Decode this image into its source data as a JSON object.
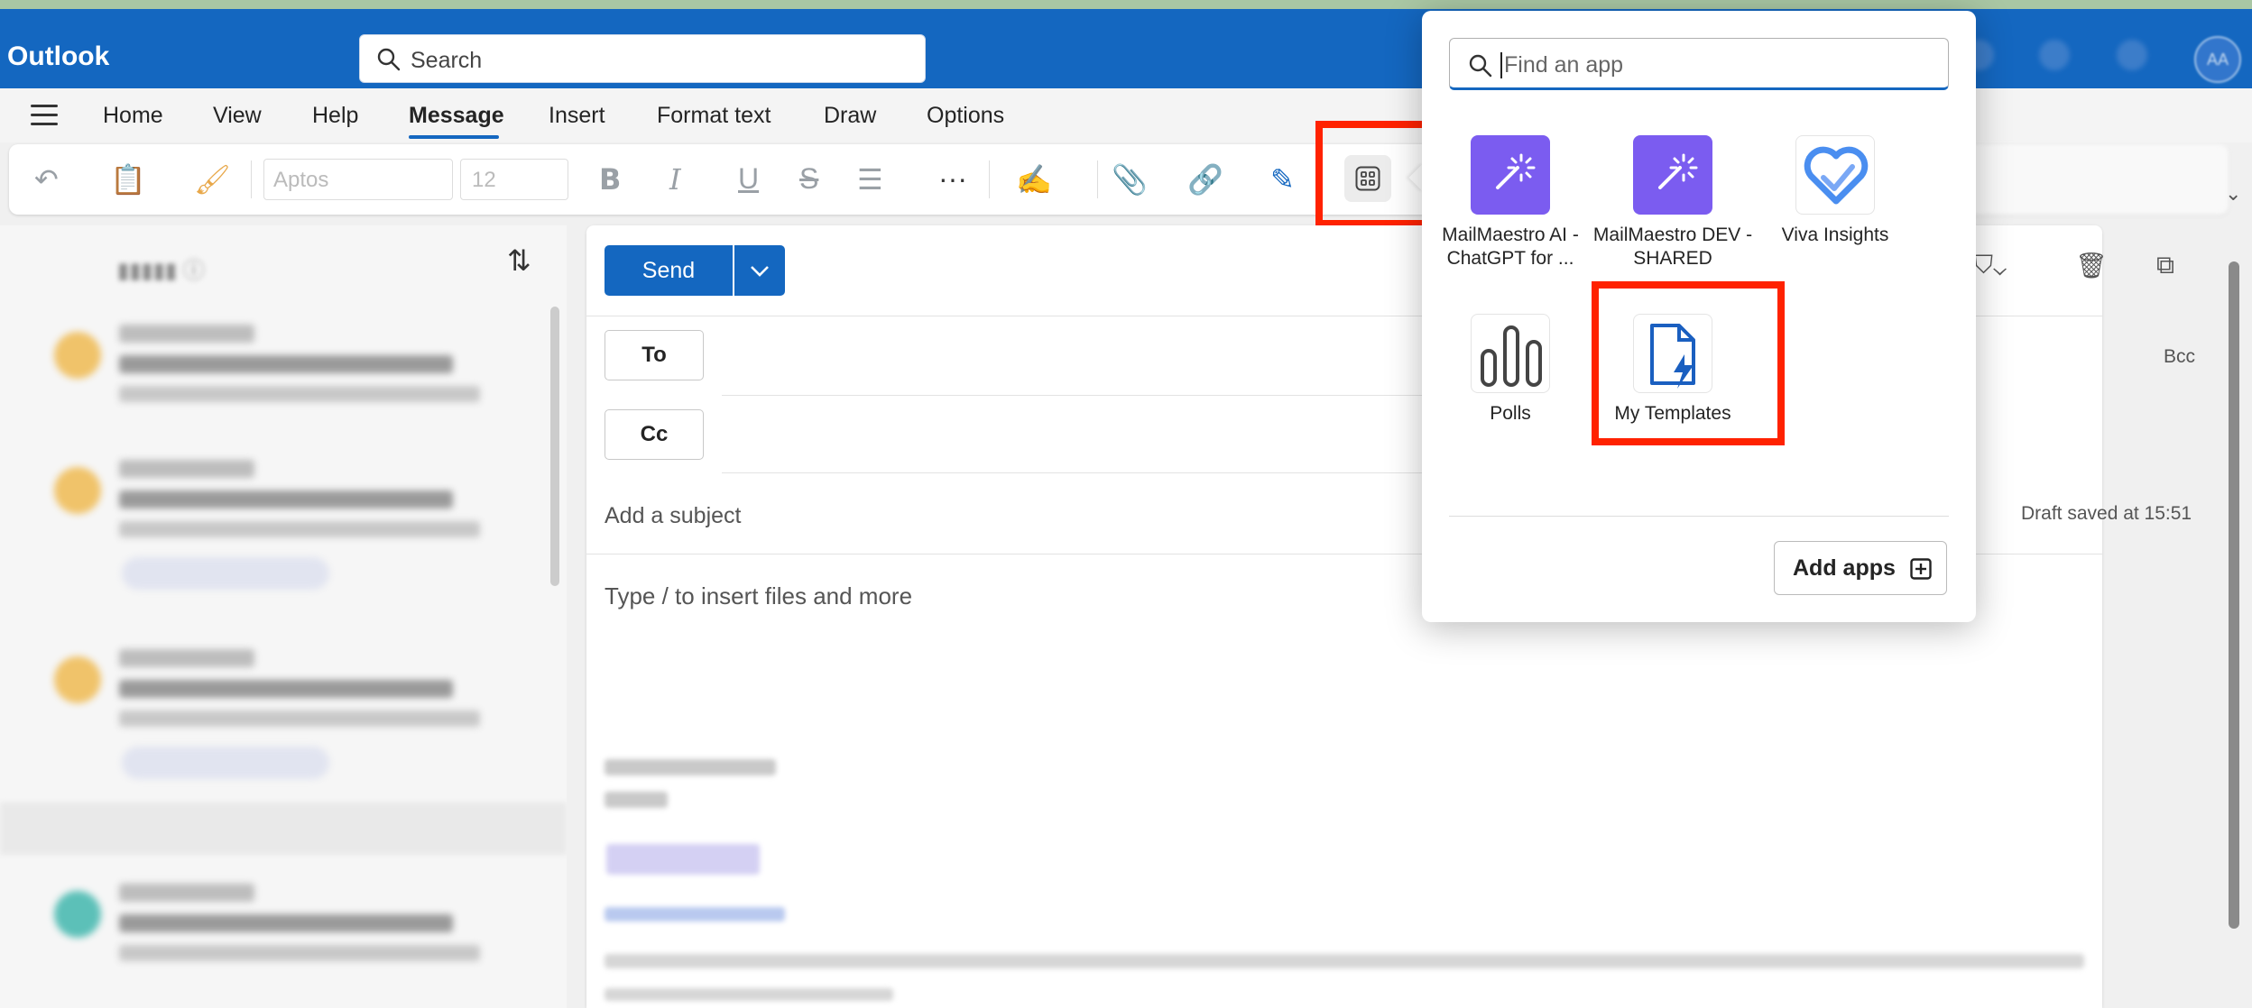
{
  "header": {
    "app_name": "Outlook",
    "search_placeholder": "Search",
    "avatar_initials": "AA"
  },
  "menu": {
    "tabs": [
      "Home",
      "View",
      "Help",
      "Message",
      "Insert",
      "Format text",
      "Draw",
      "Options"
    ],
    "active_tab": "Message"
  },
  "ribbon": {
    "font_name": "Aptos",
    "font_size": "12"
  },
  "compose": {
    "send_label": "Send",
    "to_label": "To",
    "cc_label": "Cc",
    "bcc_label": "Bcc",
    "subject_placeholder": "Add a subject",
    "body_placeholder": "Type / to insert files and more",
    "draft_status": "Draft saved at 15:51"
  },
  "apps_popup": {
    "search_placeholder": "Find an app",
    "apps": [
      {
        "label": "MailMaestro AI - ChatGPT for ...",
        "icon": "wand-icon",
        "color": "#7b5cf0"
      },
      {
        "label": "MailMaestro DEV - SHARED",
        "icon": "wand-icon",
        "color": "#7b5cf0"
      },
      {
        "label": "Viva Insights",
        "icon": "heart-check-icon",
        "color": "#4a8ef0"
      },
      {
        "label": "Polls",
        "icon": "poll-bars-icon",
        "color": "#4a4a4a"
      },
      {
        "label": "My Templates",
        "icon": "template-bolt-icon",
        "color": "#1a5fc0"
      }
    ],
    "add_apps_label": "Add apps"
  },
  "colors": {
    "brand": "#1467c0",
    "highlight": "#ff2200"
  }
}
